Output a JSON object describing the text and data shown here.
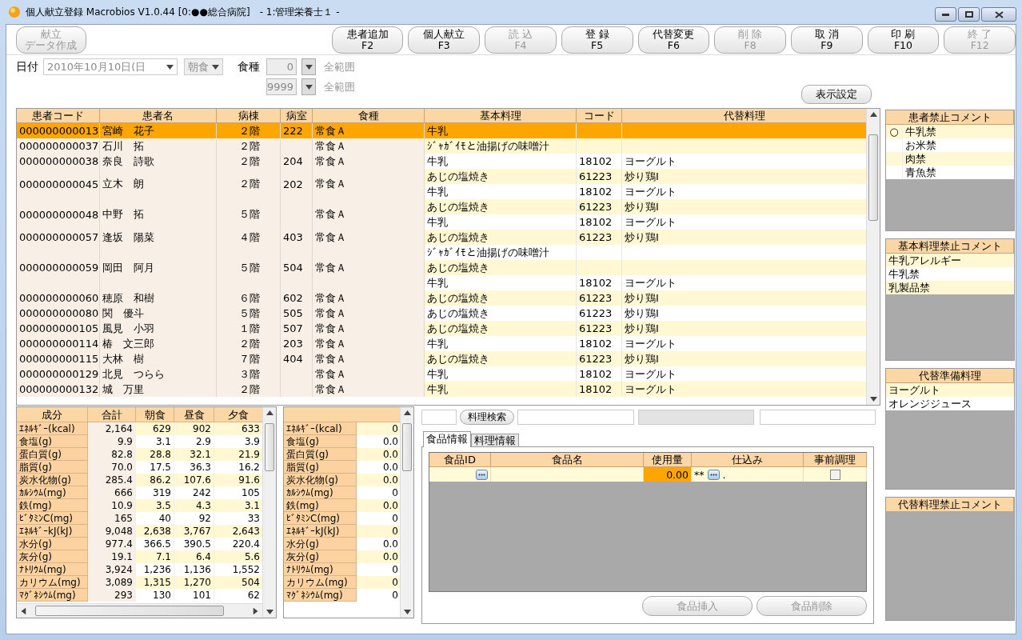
{
  "window": {
    "title": "個人献立登録 Macrobios V1.0.44 [0:●●総合病院]　- 1:管理栄養士１ -"
  },
  "toolbar": {
    "left": [
      {
        "lines": [
          "献立",
          "データ作成"
        ],
        "disabled": true
      }
    ],
    "right": [
      {
        "lines": [
          "患者追加",
          "F2"
        ],
        "disabled": false
      },
      {
        "lines": [
          "個人献立",
          "F3"
        ],
        "disabled": false
      },
      {
        "lines": [
          "読 込",
          "F4"
        ],
        "disabled": true
      },
      {
        "lines": [
          "登 録",
          "F5"
        ],
        "disabled": false
      },
      {
        "lines": [
          "代替変更",
          "F6"
        ],
        "disabled": false
      },
      {
        "lines": [
          "削 除",
          "F8"
        ],
        "disabled": true
      },
      {
        "lines": [
          "取 消",
          "F9"
        ],
        "disabled": false
      },
      {
        "lines": [
          "印 刷",
          "F10"
        ],
        "disabled": false
      },
      {
        "lines": [
          "終 了",
          "F12"
        ],
        "disabled": true
      }
    ]
  },
  "filters": {
    "date_label": "日付",
    "date": "2010年10月10日(日",
    "meal": "朝食",
    "diet_label": "食種",
    "diet_from": "0",
    "diet_to": "9999",
    "range_from": "全範囲",
    "range_to": "全範囲",
    "display_settings": "表示設定"
  },
  "patients": {
    "columns": [
      "患者コード",
      "患者名",
      "病棟",
      "病室",
      "食種",
      "基本料理",
      "コード",
      "代替料理"
    ],
    "rows": [
      {
        "code": "000000000013",
        "name": "宮崎　花子",
        "ward": "２階",
        "room": "222",
        "diet": "常食Ａ",
        "selected": true,
        "dishes": [
          {
            "basic": "牛乳"
          }
        ]
      },
      {
        "code": "000000000037",
        "name": "石川　拓",
        "ward": "２階",
        "diet": "常食Ａ",
        "selected": false,
        "dishes": [
          {
            "basic": "ｼﾞｬｶﾞｲﾓと油揚げの味噌汁"
          }
        ]
      },
      {
        "code": "000000000038",
        "name": "奈良　詩歌",
        "ward": "２階",
        "room": "204",
        "diet": "常食Ａ",
        "selected": false,
        "dishes": [
          {
            "basic": "牛乳",
            "code": "18102",
            "substitute": "ヨーグルト"
          }
        ]
      },
      {
        "code": "000000000045",
        "name": "立木　朗",
        "ward": "２階",
        "room": "202",
        "diet": "常食Ａ",
        "selected": false,
        "dishes": [
          {
            "basic": "あじの塩焼き",
            "code": "61223",
            "substitute": "炒り鶏Ⅰ"
          },
          {
            "basic": "牛乳",
            "code": "18102",
            "substitute": "ヨーグルト"
          }
        ]
      },
      {
        "code": "000000000048",
        "name": "中野　拓",
        "ward": "５階",
        "diet": "常食Ａ",
        "selected": false,
        "dishes": [
          {
            "basic": "あじの塩焼き",
            "code": "61223",
            "substitute": "炒り鶏Ⅰ"
          },
          {
            "basic": "牛乳",
            "code": "18102",
            "substitute": "ヨーグルト"
          }
        ]
      },
      {
        "code": "000000000057",
        "name": "逢坂　陽菜",
        "ward": "４階",
        "room": "403",
        "diet": "常食Ａ",
        "selected": false,
        "dishes": [
          {
            "basic": "あじの塩焼き",
            "code": "61223",
            "substitute": "炒り鶏Ⅰ"
          }
        ]
      },
      {
        "code": "000000000059",
        "name": "岡田　阿月",
        "ward": "５階",
        "room": "504",
        "diet": "常食Ａ",
        "selected": false,
        "dishes": [
          {
            "basic": "ｼﾞｬｶﾞｲﾓと油揚げの味噌汁"
          },
          {
            "basic": "あじの塩焼き"
          },
          {
            "basic": "牛乳",
            "code": "18102",
            "substitute": "ヨーグルト"
          }
        ]
      },
      {
        "code": "000000000060",
        "name": "穂原　和樹",
        "ward": "６階",
        "room": "602",
        "diet": "常食Ａ",
        "selected": false,
        "dishes": [
          {
            "basic": "あじの塩焼き",
            "code": "61223",
            "substitute": "炒り鶏Ⅰ"
          }
        ]
      },
      {
        "code": "000000000080",
        "name": "関　優斗",
        "ward": "５階",
        "room": "505",
        "diet": "常食Ａ",
        "selected": false,
        "dishes": [
          {
            "basic": "あじの塩焼き",
            "code": "61223",
            "substitute": "炒り鶏Ⅰ"
          }
        ]
      },
      {
        "code": "000000000105",
        "name": "風見　小羽",
        "ward": "１階",
        "room": "507",
        "diet": "常食Ａ",
        "selected": false,
        "dishes": [
          {
            "basic": "あじの塩焼き",
            "code": "61223",
            "substitute": "炒り鶏Ⅰ"
          }
        ]
      },
      {
        "code": "000000000114",
        "name": "椿　文三郎",
        "ward": "２階",
        "room": "203",
        "diet": "常食Ａ",
        "selected": false,
        "dishes": [
          {
            "basic": "牛乳",
            "code": "18102",
            "substitute": "ヨーグルト"
          }
        ]
      },
      {
        "code": "000000000115",
        "name": "大林　樹",
        "ward": "７階",
        "room": "404",
        "diet": "常食Ａ",
        "selected": false,
        "dishes": [
          {
            "basic": "あじの塩焼き",
            "code": "61223",
            "substitute": "炒り鶏Ⅰ"
          }
        ]
      },
      {
        "code": "000000000129",
        "name": "北見　つらら",
        "ward": "３階",
        "diet": "常食Ａ",
        "selected": false,
        "dishes": [
          {
            "basic": "牛乳",
            "code": "18102",
            "substitute": "ヨーグルト"
          }
        ]
      },
      {
        "code": "000000000132",
        "name": "城　万里",
        "ward": "２階",
        "diet": "常食Ａ",
        "selected": false,
        "dishes": [
          {
            "basic": "牛乳",
            "code": "18102",
            "substitute": "ヨーグルト"
          }
        ]
      }
    ]
  },
  "patient_ban_comments": {
    "title": "患者禁止コメント",
    "items": [
      {
        "mark": "○",
        "text": "牛乳禁"
      },
      {
        "text": "お米禁"
      },
      {
        "text": "肉禁"
      },
      {
        "text": "青魚禁"
      }
    ]
  },
  "dish_ban_comments": {
    "title": "基本料理禁止コメント",
    "items": [
      {
        "text": "牛乳アレルギー"
      },
      {
        "text": "牛乳禁"
      },
      {
        "text": "乳製品禁"
      }
    ]
  },
  "substitute_dishes": {
    "title": "代替準備料理",
    "items": [
      {
        "text": "ヨーグルト"
      },
      {
        "text": "オレンジジュース"
      }
    ]
  },
  "substitute_ban_comments": {
    "title": "代替料理禁止コメント"
  },
  "nutrition": {
    "columns": [
      "成分",
      "合計",
      "朝食",
      "昼食",
      "夕食"
    ],
    "rows": [
      {
        "name": "ｴﾈﾙｷﾞｰ(kcal)",
        "values": [
          "2,164",
          "629",
          "902",
          "633"
        ]
      },
      {
        "name": "食塩(g)",
        "values": [
          "9.9",
          "3.1",
          "2.9",
          "3.9"
        ]
      },
      {
        "name": "蛋白質(g)",
        "values": [
          "82.8",
          "28.8",
          "32.1",
          "21.9"
        ]
      },
      {
        "name": "脂質(g)",
        "values": [
          "70.0",
          "17.5",
          "36.3",
          "16.2"
        ]
      },
      {
        "name": "炭水化物(g)",
        "values": [
          "285.4",
          "86.2",
          "107.6",
          "91.6"
        ]
      },
      {
        "name": "ｶﾙｼｳﾑ(mg)",
        "values": [
          "666",
          "319",
          "242",
          "105"
        ]
      },
      {
        "name": "鉄(mg)",
        "values": [
          "10.9",
          "3.5",
          "4.3",
          "3.1"
        ]
      },
      {
        "name": "ﾋﾞﾀﾐﾝC(mg)",
        "values": [
          "165",
          "40",
          "92",
          "33"
        ]
      },
      {
        "name": "ｴﾈﾙｷﾞｰkJ(kJ)",
        "values": [
          "9,048",
          "2,638",
          "3,767",
          "2,643"
        ]
      },
      {
        "name": "水分(g)",
        "values": [
          "977.4",
          "366.5",
          "390.5",
          "220.4"
        ]
      },
      {
        "name": "灰分(g)",
        "values": [
          "19.1",
          "7.1",
          "6.4",
          "5.6"
        ]
      },
      {
        "name": "ﾅﾄﾘｳﾑ(mg)",
        "values": [
          "3,924",
          "1,236",
          "1,136",
          "1,552"
        ]
      },
      {
        "name": "カリウム(mg)",
        "values": [
          "3,089",
          "1,315",
          "1,270",
          "504"
        ]
      },
      {
        "name": "ﾏｸﾞﾈｼｳﾑ(mg)",
        "values": [
          "293",
          "130",
          "101",
          "62"
        ]
      }
    ]
  },
  "dish_nutrition": {
    "rows": [
      {
        "name": "ｴﾈﾙｷﾞｰ(kcal)",
        "value": "0"
      },
      {
        "name": "食塩(g)",
        "value": "0.0"
      },
      {
        "name": "蛋白質(g)",
        "value": "0.0"
      },
      {
        "name": "脂質(g)",
        "value": "0.0"
      },
      {
        "name": "炭水化物(g)",
        "value": "0.0"
      },
      {
        "name": "ｶﾙｼｳﾑ(mg)",
        "value": "0"
      },
      {
        "name": "鉄(mg)",
        "value": "0.0"
      },
      {
        "name": "ﾋﾞﾀﾐﾝC(mg)",
        "value": "0"
      },
      {
        "name": "ｴﾈﾙｷﾞｰkJ(kJ)",
        "value": "0"
      },
      {
        "name": "水分(g)",
        "value": "0.0"
      },
      {
        "name": "灰分(g)",
        "value": "0.0"
      },
      {
        "name": "ﾅﾄﾘｳﾑ(mg)",
        "value": "0"
      },
      {
        "name": "カリウム(mg)",
        "value": "0"
      },
      {
        "name": "ﾏｸﾞﾈｼｳﾑ(mg)",
        "value": "0"
      }
    ]
  },
  "dish_search": {
    "button": "料理検索"
  },
  "food_tabs": [
    {
      "label": "食品情報",
      "selected": true
    },
    {
      "label": "料理情報",
      "selected": false
    }
  ],
  "food_table": {
    "columns": [
      "食品ID",
      "食品名",
      "使用量",
      "仕込み",
      "事前調理"
    ],
    "rows": [
      {
        "amount": "0.00",
        "prep_prefix": "**",
        "prep_suffix": ".",
        "pre_cooked": false
      }
    ]
  },
  "food_buttons": [
    {
      "label": "食品挿入",
      "disabled": true
    },
    {
      "label": "食品削除",
      "disabled": true
    }
  ]
}
